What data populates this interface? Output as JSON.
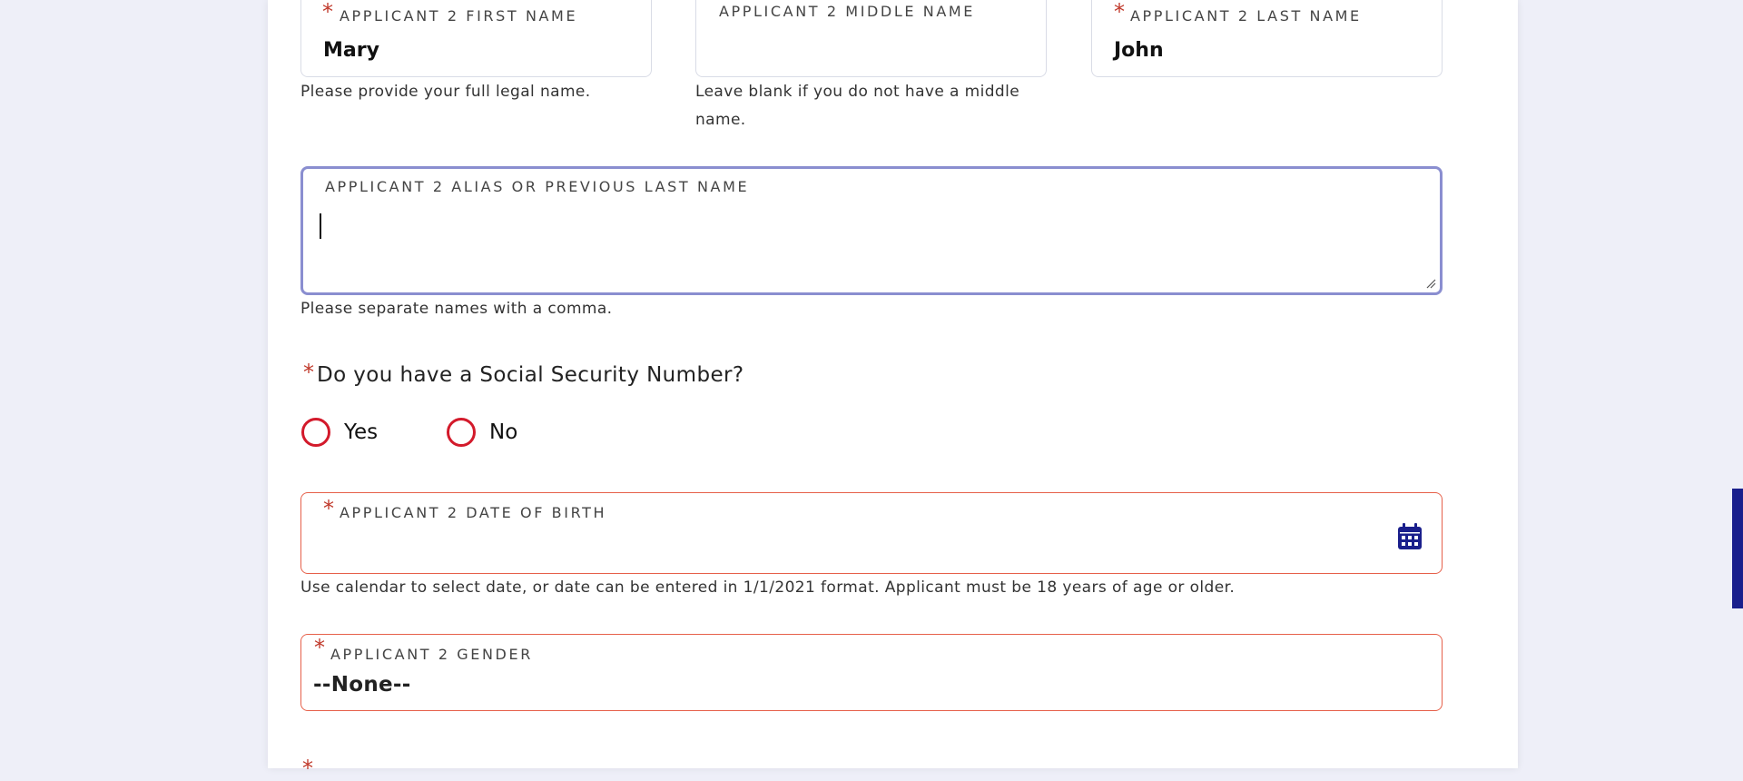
{
  "form": {
    "first_name": {
      "label": "Applicant 2 First Name",
      "value": "Mary",
      "help": "Please provide your full legal name.",
      "required_mark": "*"
    },
    "middle_name": {
      "label": "Applicant 2 Middle Name",
      "value": "",
      "help_line1": "Leave blank if you do not have a middle",
      "help_line2": "name."
    },
    "last_name": {
      "label": "Applicant 2 Last Name",
      "value": "John",
      "required_mark": "*"
    },
    "alias": {
      "label": "Applicant 2 Alias or Previous Last Name",
      "value": "",
      "help": "Please separate names with a comma."
    },
    "ssn_question": {
      "required_mark": "*",
      "text": "Do you have a Social Security Number?",
      "options": [
        "Yes",
        "No"
      ],
      "selected": null
    },
    "date_of_birth": {
      "label": "Applicant 2 Date of Birth",
      "value": "",
      "icon": "calendar-icon",
      "help": "Use calendar to select date, or date can be entered in 1/1/2021 format. Applicant must be 18 years of age or older.",
      "required_mark": "*"
    },
    "gender": {
      "label": "Applicant 2 Gender",
      "selected": "--None--",
      "required_mark": "*"
    },
    "next_question_partial": {
      "required_mark": "*"
    }
  },
  "colors": {
    "accent_navy": "#1a1f8c",
    "error_red": "#e6604a",
    "radio_red": "#d31a2b",
    "focus_border": "#8a8ed0",
    "background": "#eeeff8"
  }
}
